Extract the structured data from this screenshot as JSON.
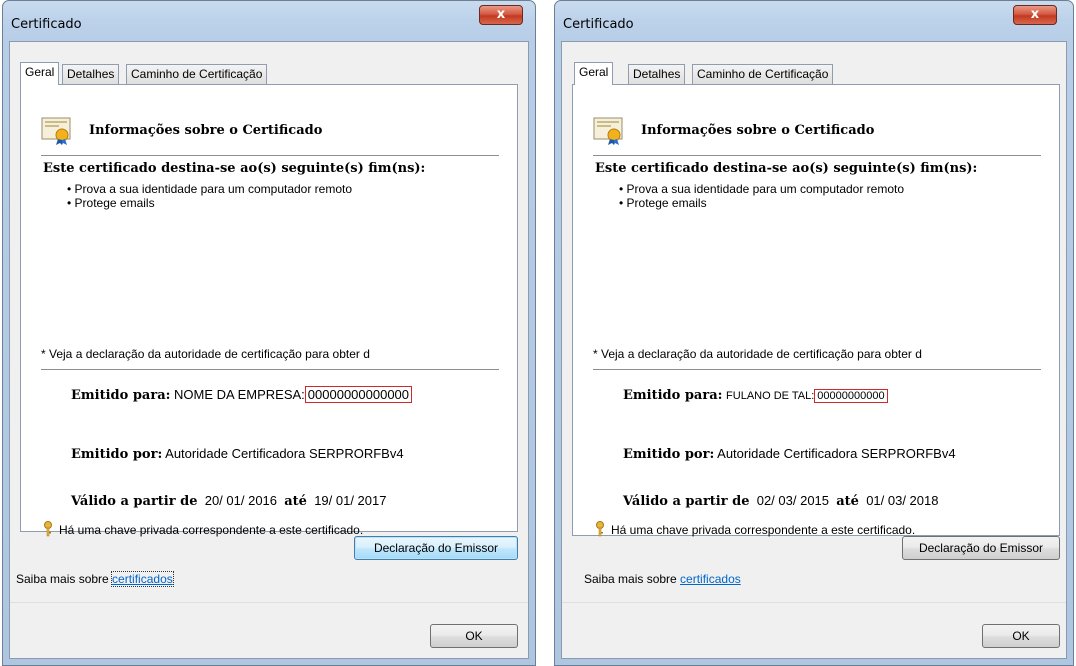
{
  "dialogs": [
    {
      "title": "Certificado",
      "tabs": [
        "Geral",
        "Detalhes",
        "Caminho de Certificação"
      ],
      "info_title": "Informações sobre o Certificado",
      "purpose_heading": "Este certificado destina-se ao(s) seguinte(s) fim(ns):",
      "purposes": [
        "• Prova a sua identidade para um computador remoto",
        "• Protege emails"
      ],
      "note": "* Veja a declaração da autoridade de certificação para obter d",
      "issued_to_label": "Emitido para:",
      "issued_to_value": "NOME DA EMPRESA:",
      "issued_to_id": "00000000000000",
      "issued_by_label": "Emitido por:",
      "issued_by_value": "Autoridade Certificadora SERPRORFBv4",
      "valid_from_label": "Válido a partir de",
      "valid_from": "20/ 01/ 2016",
      "valid_to_label": "até",
      "valid_to": "19/ 01/ 2017",
      "private_key_note": "Há uma chave privada correspondente a este certificado.",
      "issuer_statement_button": "Declaração do Emissor",
      "learn_more_text": "Saiba mais sobre ",
      "learn_more_link": "certificados",
      "ok_button": "OK",
      "close_glyph": "x"
    },
    {
      "title": "Certificado",
      "tabs": [
        "Geral",
        "Detalhes",
        "Caminho de Certificação"
      ],
      "info_title": "Informações sobre o Certificado",
      "purpose_heading": "Este certificado destina-se ao(s) seguinte(s) fim(ns):",
      "purposes": [
        "• Prova a sua identidade para um computador remoto",
        "• Protege emails"
      ],
      "note": "* Veja a declaração da autoridade de certificação para obter d",
      "issued_to_label": "Emitido para:",
      "issued_to_value": "FULANO DE TAL:",
      "issued_to_id": "00000000000",
      "issued_by_label": "Emitido por:",
      "issued_by_value": "Autoridade Certificadora SERPRORFBv4",
      "valid_from_label": "Válido a partir de",
      "valid_from": "02/ 03/ 2015",
      "valid_to_label": "até",
      "valid_to": "01/ 03/ 2018",
      "private_key_note": "Há uma chave privada correspondente a este certificado.",
      "issuer_statement_button": "Declaração do Emissor",
      "learn_more_text": "Saiba mais sobre ",
      "learn_more_link": "certificados",
      "ok_button": "OK",
      "close_glyph": "x"
    }
  ],
  "colors": {
    "highlight_box": "#d12828",
    "link": "#0066cc",
    "close_button": "#c23a22"
  },
  "icons": [
    "certificate-icon",
    "key-icon",
    "close-icon"
  ]
}
